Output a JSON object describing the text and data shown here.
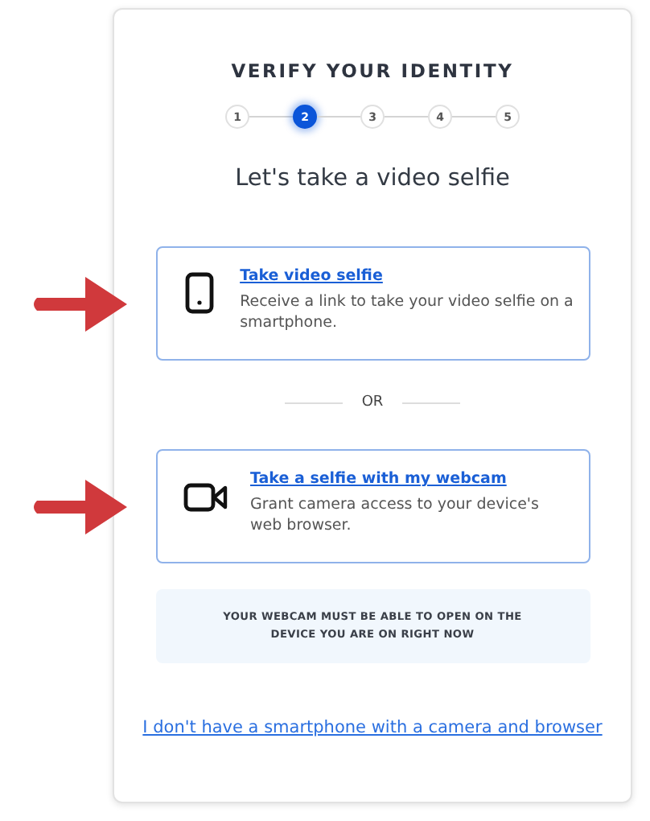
{
  "title": "VERIFY YOUR IDENTITY",
  "steps": [
    {
      "label": "1",
      "selected": false
    },
    {
      "label": "2",
      "selected": true
    },
    {
      "label": "3",
      "selected": false
    },
    {
      "label": "4",
      "selected": false
    },
    {
      "label": "5",
      "selected": false
    }
  ],
  "heading": "Let's take a video selfie",
  "options": [
    {
      "kind": "phone",
      "title": "Take video selfie",
      "description": "Receive a link to take your video selfie on a smartphone.",
      "highlighted": true
    },
    {
      "kind": "webcam",
      "title": "Take a selfie with my webcam",
      "description": "Grant camera access to your device's web browser.",
      "highlighted": true
    }
  ],
  "divider": "OR",
  "notice": "YOUR WEBCAM MUST BE ABLE TO OPEN ON THE DEVICE YOU ARE ON RIGHT NOW",
  "footer_link": "I don't have a smartphone with a camera and browser"
}
